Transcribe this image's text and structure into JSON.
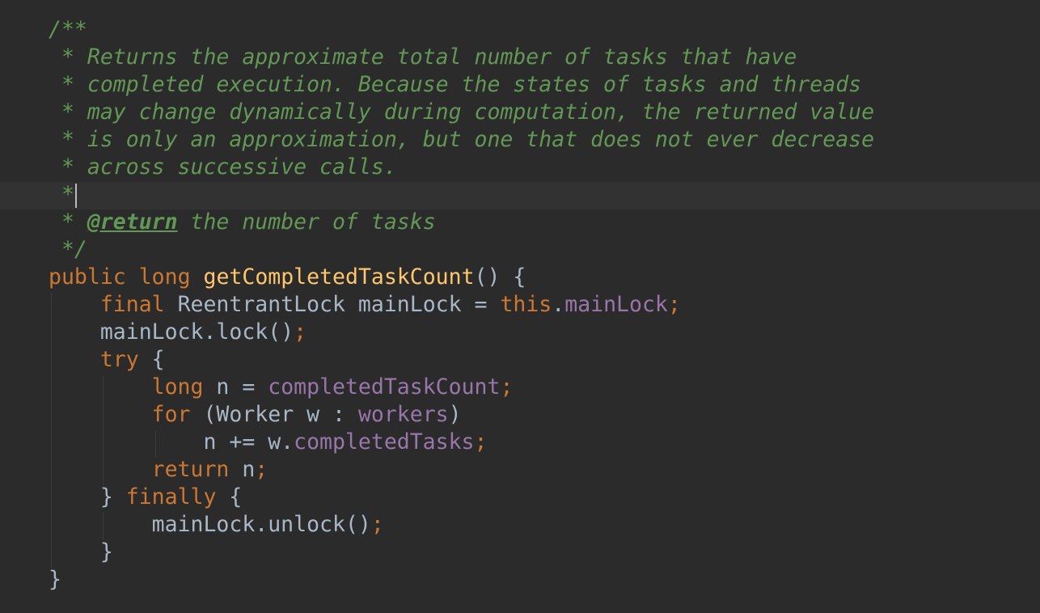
{
  "editor": {
    "doc_open": "/**",
    "doc_line_1": " * Returns the approximate total number of tasks that have",
    "doc_line_2": " * completed execution. Because the states of tasks and threads",
    "doc_line_3": " * may change dynamically during computation, the returned value",
    "doc_line_4": " * is only an approximation, but one that does not ever decrease",
    "doc_line_5": " * across successive calls.",
    "doc_empty": " *",
    "doc_return_prefix": " * ",
    "doc_return_tag": "@return",
    "doc_return_text": " the number of tasks",
    "doc_close": " */",
    "sig_public": "public",
    "sig_long": "long",
    "sig_method": "getCompletedTaskCount",
    "sig_rest": "() {",
    "l1_final": "final",
    "l1_text": " ReentrantLock mainLock = ",
    "l1_this": "this",
    "l1_dot": ".",
    "l1_field": "mainLock",
    "l1_semi": ";",
    "l2_text": "mainLock.lock()",
    "l2_semi": ";",
    "l3_try": "try",
    "l3_brace": " {",
    "l4_long": "long",
    "l4_text": " n = ",
    "l4_field": "completedTaskCount",
    "l4_semi": ";",
    "l5_for": "for",
    "l5_text1": " (Worker w : ",
    "l5_field": "workers",
    "l5_text2": ")",
    "l6_text": "n += w.",
    "l6_field": "completedTasks",
    "l6_semi": ";",
    "l7_return": "return",
    "l7_text": " n",
    "l7_semi": ";",
    "l8_brace": "} ",
    "l8_finally": "finally",
    "l8_brace2": " {",
    "l9_text": "mainLock.unlock()",
    "l9_semi": ";",
    "l10_brace": "}",
    "l11_brace": "}"
  },
  "colors": {
    "background": "#2b2b2b",
    "current_line": "#323232",
    "doc_comment": "#629755",
    "keyword": "#cc7832",
    "method": "#ffc66d",
    "field": "#9876aa",
    "plain": "#a9b7c6"
  }
}
